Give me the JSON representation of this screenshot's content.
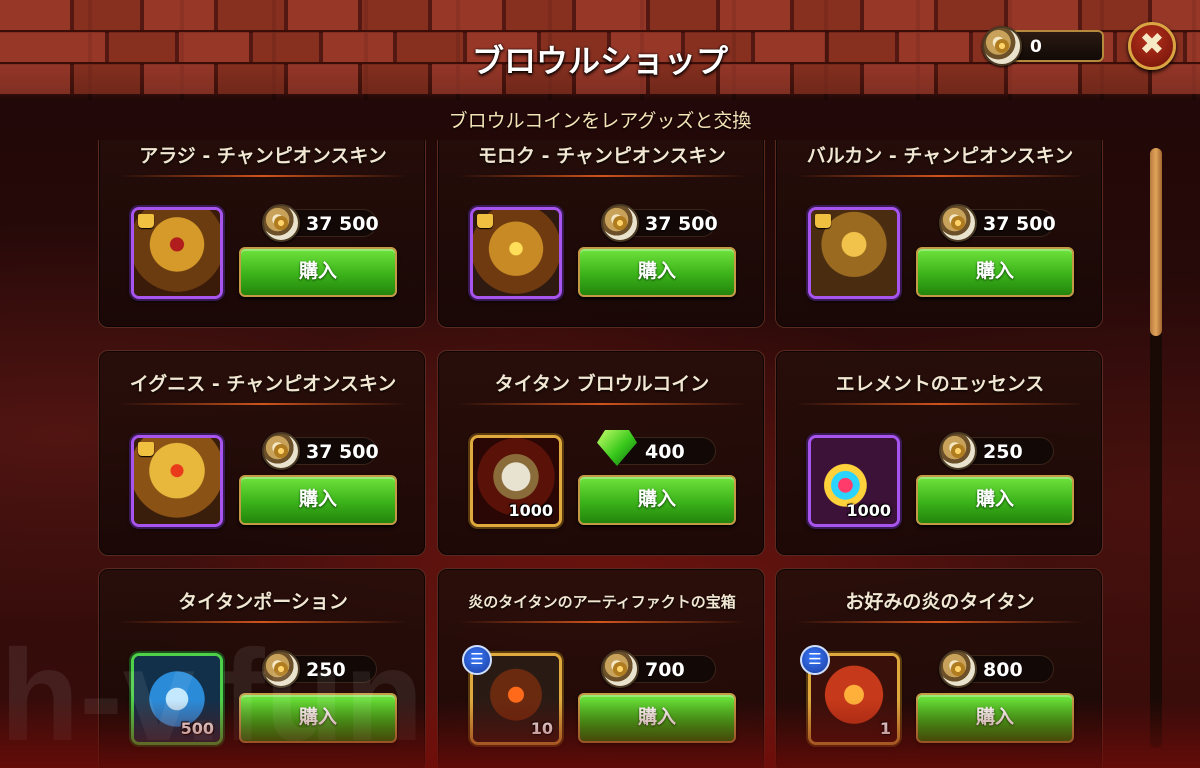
{
  "header": {
    "title": "ブロウルショップ",
    "subtitle": "ブロウルコインをレアグッズと交換",
    "currency_amount": "0",
    "close_label": "✖"
  },
  "shop": {
    "buy_label": "購入",
    "items": [
      {
        "name": "アラジ - チャンピオンスキン",
        "price": "37 500",
        "currency": "brawl-coin-icon",
        "art": "skin1",
        "frame": "purple",
        "badge": "shirt"
      },
      {
        "name": "モロク - チャンピオンスキン",
        "price": "37 500",
        "currency": "brawl-coin-icon",
        "art": "skin2",
        "frame": "purple",
        "badge": "shirt"
      },
      {
        "name": "バルカン - チャンピオンスキン",
        "price": "37 500",
        "currency": "brawl-coin-icon",
        "art": "skin3",
        "frame": "purple",
        "badge": "shirt"
      },
      {
        "name": "イグニス - チャンピオンスキン",
        "price": "37 500",
        "currency": "brawl-coin-icon",
        "art": "skin4",
        "frame": "purple",
        "badge": "shirt"
      },
      {
        "name": "タイタン ブロウルコイン",
        "price": "400",
        "currency": "emerald-icon",
        "art": "coinbox",
        "frame": "gold",
        "quantity": "1000"
      },
      {
        "name": "エレメントのエッセンス",
        "price": "250",
        "currency": "brawl-coin-icon",
        "art": "essence",
        "frame": "purple",
        "quantity": "1000"
      },
      {
        "name": "タイタンポーション",
        "price": "250",
        "currency": "brawl-coin-icon",
        "art": "potion",
        "frame": "green",
        "quantity": "500"
      },
      {
        "name": "炎のタイタンのアーティファクトの宝箱",
        "price": "700",
        "currency": "brawl-coin-icon",
        "art": "chest1",
        "frame": "gold",
        "quantity": "10",
        "badge": "list"
      },
      {
        "name": "お好みの炎のタイタン",
        "price": "800",
        "currency": "brawl-coin-icon",
        "art": "chest2",
        "frame": "gold",
        "quantity": "1",
        "badge": "list"
      }
    ]
  },
  "watermark": "h-v.fun",
  "colors": {
    "buy_button": "#3bb21a",
    "frame_purple": "#a855f0",
    "frame_gold": "#e0a93e",
    "frame_green": "#4fd04a",
    "accent_divider": "#d0541c"
  }
}
